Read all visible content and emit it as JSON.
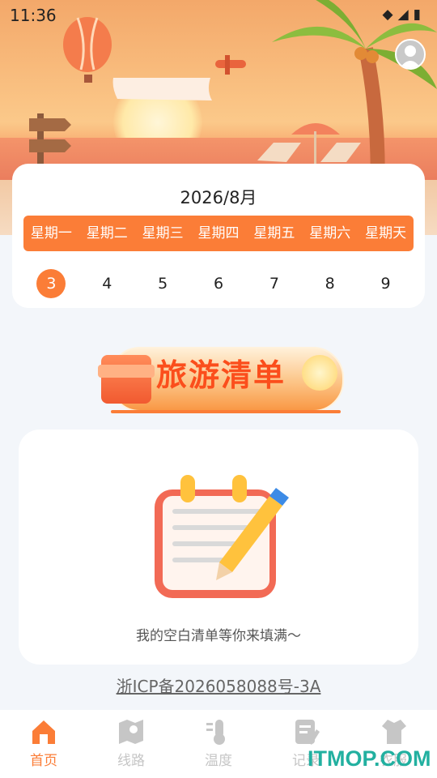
{
  "status_bar": {
    "time": "11:36",
    "icons": [
      "wifi-icon",
      "signal-icon",
      "battery-icon"
    ]
  },
  "calendar": {
    "title": "2026/8月",
    "weekdays": [
      "星期一",
      "星期二",
      "星期三",
      "星期四",
      "星期五",
      "星期六",
      "星期天"
    ],
    "dates": [
      "3",
      "4",
      "5",
      "6",
      "7",
      "8",
      "9"
    ],
    "selected_date": "3"
  },
  "banner": {
    "title": "旅游清单"
  },
  "checklist": {
    "empty_message": "我的空白清单等你来填满～"
  },
  "footer": {
    "icp": "浙ICP备2026058088号-3A"
  },
  "tabs": [
    {
      "label": "首页",
      "icon": "home-icon",
      "active": true
    },
    {
      "label": "线路",
      "icon": "map-icon",
      "active": false
    },
    {
      "label": "温度",
      "icon": "thermometer-icon",
      "active": false
    },
    {
      "label": "记录",
      "icon": "note-icon",
      "active": false
    },
    {
      "label": "衣服",
      "icon": "clothes-icon",
      "active": false
    }
  ],
  "watermark": "ITMOP.COM",
  "colors": {
    "accent": "#fb7d37",
    "inactive": "#c6c6c6",
    "background": "#f3f6fa"
  }
}
